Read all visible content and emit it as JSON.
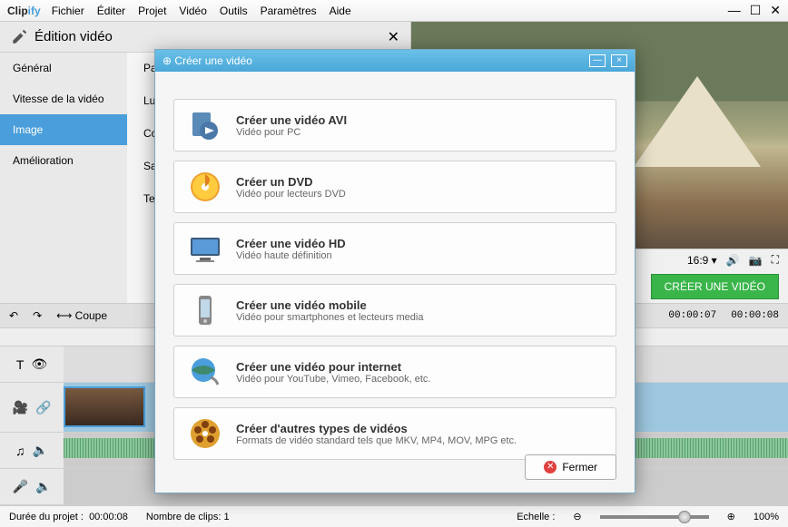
{
  "app": {
    "logo_a": "Clip",
    "logo_b": "ify"
  },
  "menu": [
    "Fichier",
    "Éditer",
    "Projet",
    "Vidéo",
    "Outils",
    "Paramètres",
    "Aide"
  ],
  "edit_panel": {
    "title": "Édition vidéo",
    "tabs": [
      "Général",
      "Vitesse de la vidéo",
      "Image",
      "Amélioration"
    ],
    "active_index": 2,
    "rows": [
      "Para",
      "Lu",
      "Co",
      "Sa",
      "Te"
    ]
  },
  "preview": {
    "aspect": "16:9",
    "create_label": "CRÉER UNE VIDÉO"
  },
  "toolbar2": {
    "cut": "Coupe"
  },
  "timeline": {
    "times": [
      "00:00:07",
      "00:00:08"
    ]
  },
  "status": {
    "duration_label": "Durée du projet :",
    "duration_value": "00:00:08",
    "clips_label": "Nombre de clips:",
    "clips_value": "1",
    "scale_label": "Echelle :",
    "zoom_pct": "100%"
  },
  "modal": {
    "title": "Créer une vidéo",
    "options": [
      {
        "title": "Créer une vidéo AVI",
        "desc": "Vidéo pour PC",
        "icon": "avi"
      },
      {
        "title": "Créer un DVD",
        "desc": "Vidéo pour lecteurs DVD",
        "icon": "dvd"
      },
      {
        "title": "Créer une vidéo HD",
        "desc": "Vidéo haute définition",
        "icon": "hd"
      },
      {
        "title": "Créer une vidéo mobile",
        "desc": "Vidéo pour smartphones et lecteurs media",
        "icon": "mobile"
      },
      {
        "title": "Créer une vidéo pour internet",
        "desc": "Vidéo pour YouTube, Vimeo, Facebook, etc.",
        "icon": "web"
      },
      {
        "title": "Créer d'autres types de vidéos",
        "desc": "Formats de vidéo standard tels que MKV, MP4, MOV, MPG etc.",
        "icon": "reel"
      }
    ],
    "close": "Fermer"
  }
}
